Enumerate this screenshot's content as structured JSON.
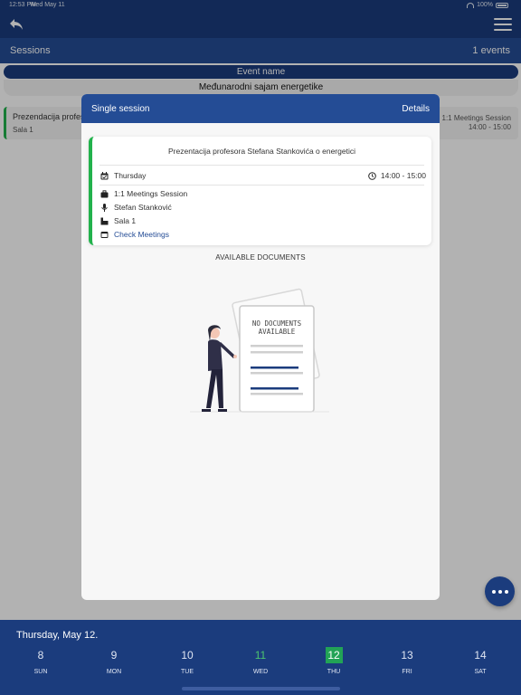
{
  "status_bar": {
    "time": "12:53 PM",
    "date": "Wed May 11",
    "battery": "100%"
  },
  "header": {
    "back_icon": "back-arrow-icon",
    "menu_icon": "hamburger-menu-icon"
  },
  "sessions_bar": {
    "title": "Sessions",
    "count": "1 events"
  },
  "event": {
    "label": "Event name",
    "value": "Međunarodni sajam energetike"
  },
  "list_session": {
    "name": "Prezendacija profesor",
    "place": "Sala 1",
    "type": "1:1 Meetings Session",
    "hours": "14:00 - 15:00"
  },
  "modal": {
    "title": "Single session",
    "details_label": "Details",
    "session": {
      "title": "Prezentacija profesora Stefana Stankovića o energetici",
      "day": "Thursday",
      "time": "14:00 - 15:00",
      "type": "1:1 Meetings Session",
      "speaker": "Stefan Stanković",
      "room": "Sala 1",
      "check_meetings": "Check Meetings"
    },
    "documents_title": "AVAILABLE DOCUMENTS",
    "no_documents_line1": "NO DOCUMENTS",
    "no_documents_line2": "AVAILABLE"
  },
  "week": {
    "label": "Thursday, May 12.",
    "days": [
      {
        "num": "8",
        "dow": "SUN"
      },
      {
        "num": "9",
        "dow": "MON"
      },
      {
        "num": "10",
        "dow": "TUE"
      },
      {
        "num": "11",
        "dow": "WED"
      },
      {
        "num": "12",
        "dow": "THU"
      },
      {
        "num": "13",
        "dow": "FRI"
      },
      {
        "num": "14",
        "dow": "SAT"
      }
    ],
    "today_index": 3,
    "selected_index": 4
  },
  "colors": {
    "primary": "#1b3c7d",
    "secondary": "#244c95",
    "accent_green": "#22b24c"
  }
}
